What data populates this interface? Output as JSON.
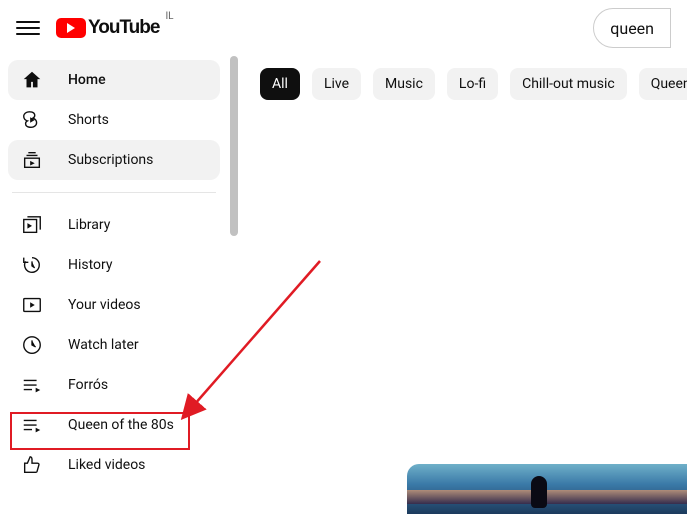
{
  "header": {
    "brand": "YouTube",
    "country": "IL",
    "search_value": "queen"
  },
  "sidebar": {
    "home": "Home",
    "shorts": "Shorts",
    "subscriptions": "Subscriptions",
    "library": "Library",
    "history": "History",
    "your_videos": "Your videos",
    "watch_later": "Watch later",
    "playlist_a": "Forrós",
    "playlist_b": "Queen of the 80s",
    "liked": "Liked videos"
  },
  "chips": {
    "all": "All",
    "live": "Live",
    "music": "Music",
    "lofi": "Lo-fi",
    "chill": "Chill-out music",
    "queen": "Queen"
  }
}
